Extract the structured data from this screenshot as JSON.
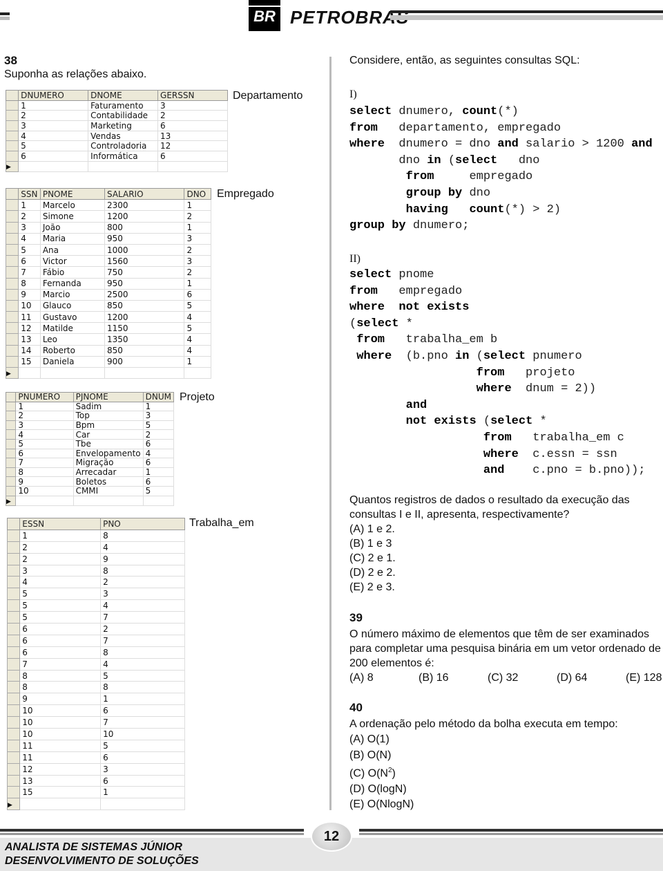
{
  "header": {
    "logo_mark": "BR",
    "logo_text": "PETROBRAS"
  },
  "q38": {
    "number": "38",
    "intro": "Suponha as relações abaixo.",
    "tables": [
      {
        "label": "Departamento",
        "columns": [
          "DNUMERO",
          "DNOME",
          "GERSSN"
        ],
        "rows": [
          [
            "1",
            "Faturamento",
            "3"
          ],
          [
            "2",
            "Contabilidade",
            "2"
          ],
          [
            "3",
            "Marketing",
            "6"
          ],
          [
            "4",
            "Vendas",
            "13"
          ],
          [
            "5",
            "Controladoria",
            "12"
          ],
          [
            "6",
            "Informática",
            "6"
          ]
        ]
      },
      {
        "label": "Empregado",
        "columns": [
          "SSN",
          "PNOME",
          "SALARIO",
          "DNO"
        ],
        "rows": [
          [
            "1",
            "Marcelo",
            "2300",
            "1"
          ],
          [
            "2",
            "Simone",
            "1200",
            "2"
          ],
          [
            "3",
            "João",
            "800",
            "1"
          ],
          [
            "4",
            "Maria",
            "950",
            "3"
          ],
          [
            "5",
            "Ana",
            "1000",
            "2"
          ],
          [
            "6",
            "Victor",
            "1560",
            "3"
          ],
          [
            "7",
            "Fábio",
            "750",
            "2"
          ],
          [
            "8",
            "Fernanda",
            "950",
            "1"
          ],
          [
            "9",
            "Marcio",
            "2500",
            "6"
          ],
          [
            "10",
            "Glauco",
            "850",
            "5"
          ],
          [
            "11",
            "Gustavo",
            "1200",
            "4"
          ],
          [
            "12",
            "Matilde",
            "1150",
            "5"
          ],
          [
            "13",
            "Leo",
            "1350",
            "4"
          ],
          [
            "14",
            "Roberto",
            "850",
            "4"
          ],
          [
            "15",
            "Daniela",
            "900",
            "1"
          ]
        ]
      },
      {
        "label": "Projeto",
        "columns": [
          "PNUMERO",
          "PJNOME",
          "DNUM"
        ],
        "rows": [
          [
            "1",
            "Sadim",
            "1"
          ],
          [
            "2",
            "Top",
            "3"
          ],
          [
            "3",
            "Bpm",
            "5"
          ],
          [
            "4",
            "Car",
            "2"
          ],
          [
            "5",
            "Tbe",
            "6"
          ],
          [
            "6",
            "Envelopamento",
            "4"
          ],
          [
            "7",
            "Migração",
            "6"
          ],
          [
            "8",
            "Arrecadar",
            "1"
          ],
          [
            "9",
            "Boletos",
            "6"
          ],
          [
            "10",
            "CMMI",
            "5"
          ]
        ]
      },
      {
        "label": "Trabalha_em",
        "columns": [
          "ESSN",
          "PNO"
        ],
        "rows": [
          [
            "1",
            "8"
          ],
          [
            "2",
            "4"
          ],
          [
            "2",
            "9"
          ],
          [
            "3",
            "8"
          ],
          [
            "4",
            "2"
          ],
          [
            "5",
            "3"
          ],
          [
            "5",
            "4"
          ],
          [
            "5",
            "7"
          ],
          [
            "6",
            "2"
          ],
          [
            "6",
            "7"
          ],
          [
            "6",
            "8"
          ],
          [
            "7",
            "4"
          ],
          [
            "8",
            "5"
          ],
          [
            "8",
            "8"
          ],
          [
            "9",
            "1"
          ],
          [
            "10",
            "6"
          ],
          [
            "10",
            "7"
          ],
          [
            "10",
            "10"
          ],
          [
            "11",
            "5"
          ],
          [
            "11",
            "6"
          ],
          [
            "12",
            "3"
          ],
          [
            "13",
            "6"
          ],
          [
            "15",
            "1"
          ]
        ]
      }
    ],
    "consider": "Considere, então, as seguintes consultas SQL:",
    "query1_label": "I)",
    "query1": [
      [
        {
          "b": "select"
        },
        {
          "t": " dnumero, "
        },
        {
          "b": "count"
        },
        {
          "t": "(*)"
        }
      ],
      [
        {
          "b": "from"
        },
        {
          "t": "   departamento, empregado"
        }
      ],
      [
        {
          "b": "where"
        },
        {
          "t": "  dnumero = dno "
        },
        {
          "b": "and"
        },
        {
          "t": " salario > 1200 "
        },
        {
          "b": "and"
        }
      ],
      [
        {
          "t": "       dno "
        },
        {
          "b": "in"
        },
        {
          "t": " ("
        },
        {
          "b": "select"
        },
        {
          "t": "   dno"
        }
      ],
      [
        {
          "t": "        "
        },
        {
          "b": "from"
        },
        {
          "t": "     empregado"
        }
      ],
      [
        {
          "t": "        "
        },
        {
          "b": "group by"
        },
        {
          "t": " dno"
        }
      ],
      [
        {
          "t": "        "
        },
        {
          "b": "having"
        },
        {
          "t": "   "
        },
        {
          "b": "count"
        },
        {
          "t": "(*) > 2)"
        }
      ],
      [
        {
          "b": "group by"
        },
        {
          "t": " dnumero;"
        }
      ]
    ],
    "query2_label": "II)",
    "query2": [
      [
        {
          "b": "select"
        },
        {
          "t": " pnome"
        }
      ],
      [
        {
          "b": "from"
        },
        {
          "t": "   empregado"
        }
      ],
      [
        {
          "b": "where"
        },
        {
          "t": "  "
        },
        {
          "b": "not exists"
        }
      ],
      [
        {
          "t": "("
        },
        {
          "b": "select"
        },
        {
          "t": " *"
        }
      ],
      [
        {
          "t": " "
        },
        {
          "b": "from"
        },
        {
          "t": "   trabalha_em b"
        }
      ],
      [
        {
          "t": " "
        },
        {
          "b": "where"
        },
        {
          "t": "  (b.pno "
        },
        {
          "b": "in"
        },
        {
          "t": " ("
        },
        {
          "b": "select"
        },
        {
          "t": " pnumero"
        }
      ],
      [
        {
          "t": "                  "
        },
        {
          "b": "from"
        },
        {
          "t": "   projeto"
        }
      ],
      [
        {
          "t": "                  "
        },
        {
          "b": "where"
        },
        {
          "t": "  dnum = 2))"
        }
      ],
      [
        {
          "t": "        "
        },
        {
          "b": "and"
        }
      ],
      [
        {
          "t": "        "
        },
        {
          "b": "not exists"
        },
        {
          "t": " ("
        },
        {
          "b": "select"
        },
        {
          "t": " *"
        }
      ],
      [
        {
          "t": "                   "
        },
        {
          "b": "from"
        },
        {
          "t": "   trabalha_em c"
        }
      ],
      [
        {
          "t": "                   "
        },
        {
          "b": "where"
        },
        {
          "t": "  c.essn = ssn"
        }
      ],
      [
        {
          "t": "                   "
        },
        {
          "b": "and"
        },
        {
          "t": "    c.pno = b.pno));"
        }
      ]
    ],
    "question": "Quantos registros de dados o resultado da execução das consultas I e II, apresenta, respectivamente?",
    "options": [
      "(A) 1 e 2.",
      "(B) 1 e 3",
      "(C) 2 e 1.",
      "(D) 2 e 2.",
      "(E) 2 e 3."
    ]
  },
  "q39": {
    "number": "39",
    "question": "O número máximo de elementos que têm de ser examinados para completar uma pesquisa binária em um vetor ordenado de 200 elementos é:",
    "options": [
      "(A) 8",
      "(B) 16",
      "(C) 32",
      "(D) 64",
      "(E) 128"
    ]
  },
  "q40": {
    "number": "40",
    "question": "A ordenação pelo método da bolha executa em tempo:",
    "options": [
      "(A) O(1)",
      "(B) O(N)",
      "(C) O(N",
      "(D) O(logN)",
      "(E) O(NlogN)"
    ],
    "option_c_sup": "2",
    "option_c_close": ")"
  },
  "footer": {
    "page": "12",
    "line1": "ANALISTA DE SISTEMAS JÚNIOR",
    "line2": "DESENVOLVIMENTO DE SOLUÇÕES"
  }
}
